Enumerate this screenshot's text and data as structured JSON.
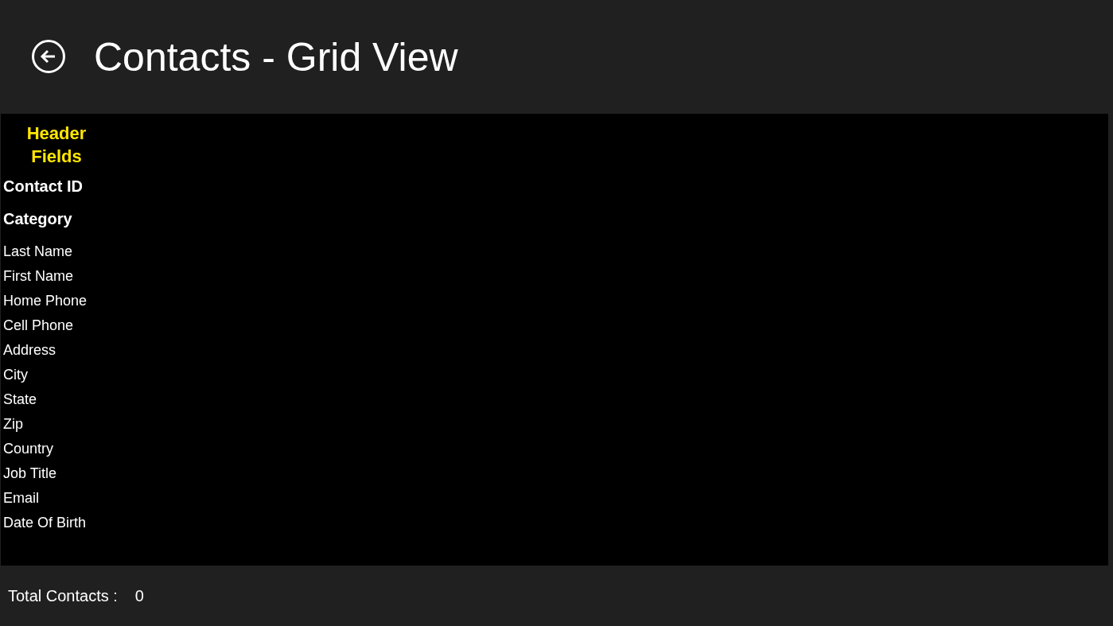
{
  "page": {
    "title": "Contacts - Grid View"
  },
  "grid": {
    "header": "Header Fields",
    "fields": [
      {
        "label": "Contact ID",
        "kind": "key"
      },
      {
        "label": "Category",
        "kind": "key"
      },
      {
        "label": "Last Name",
        "kind": "plain"
      },
      {
        "label": "First Name",
        "kind": "plain"
      },
      {
        "label": "Home Phone",
        "kind": "plain"
      },
      {
        "label": "Cell Phone",
        "kind": "plain"
      },
      {
        "label": "Address",
        "kind": "plain"
      },
      {
        "label": "City",
        "kind": "plain"
      },
      {
        "label": "State",
        "kind": "plain"
      },
      {
        "label": "Zip",
        "kind": "plain"
      },
      {
        "label": "Country",
        "kind": "plain"
      },
      {
        "label": "Job Title",
        "kind": "plain"
      },
      {
        "label": "Email",
        "kind": "plain"
      },
      {
        "label": "Date Of Birth",
        "kind": "plain"
      }
    ]
  },
  "footer": {
    "label": "Total Contacts :",
    "count": "0"
  }
}
